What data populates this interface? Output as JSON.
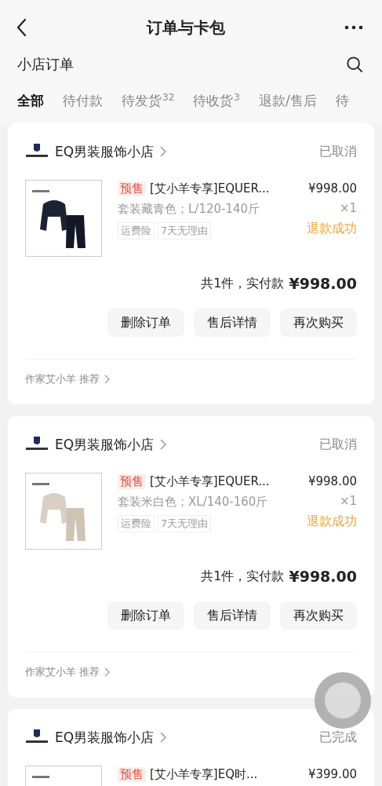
{
  "header": {
    "title": "订单与卡包"
  },
  "section": {
    "title": "小店订单"
  },
  "tabs": [
    {
      "label": "全部",
      "selected": true
    },
    {
      "label": "待付款",
      "selected": false
    },
    {
      "label": "待发货",
      "count": "32",
      "selected": false
    },
    {
      "label": "待收货",
      "count": "3",
      "selected": false
    },
    {
      "label": "退款/售后",
      "selected": false
    },
    {
      "label": "待",
      "selected": false
    }
  ],
  "orders": [
    {
      "shop": "EQ男装服饰小店",
      "status": "已取消",
      "items": [
        {
          "kind": "picture",
          "tag": "预售",
          "title": "[艾小羊专享]EQUER...",
          "spec": "套装藏青色；L/120-140斤",
          "services": [
            "运费险",
            "7天无理由"
          ],
          "price": "¥998.00",
          "qty": "×1",
          "refund": "退款成功"
        }
      ],
      "total_label": "共1件，实付款",
      "total": "¥998.00",
      "buttons": [
        "删除订单",
        "售后详情",
        "再次购买"
      ],
      "recommend": "作家艾小羊 推荐"
    },
    {
      "shop": "EQ男装服饰小店",
      "status": "已取消",
      "items": [
        {
          "kind": "picture",
          "tag": "预售",
          "title": "[艾小羊专享]EQUER...",
          "spec": "套装米白色；XL/140-160斤",
          "services": [
            "运费险",
            "7天无理由"
          ],
          "price": "¥998.00",
          "qty": "×1",
          "refund": "退款成功"
        }
      ],
      "total_label": "共1件，实付款",
      "total": "¥998.00",
      "buttons": [
        "删除订单",
        "售后详情",
        "再次购买"
      ],
      "recommend": "作家艾小羊 推荐"
    },
    {
      "shop": "EQ男装服饰小店",
      "status": "已完成",
      "items": [
        {
          "kind": "picture",
          "tag": "预售",
          "title": "[艾小羊专享]EQ时...",
          "price": "¥399.00"
        }
      ]
    }
  ]
}
